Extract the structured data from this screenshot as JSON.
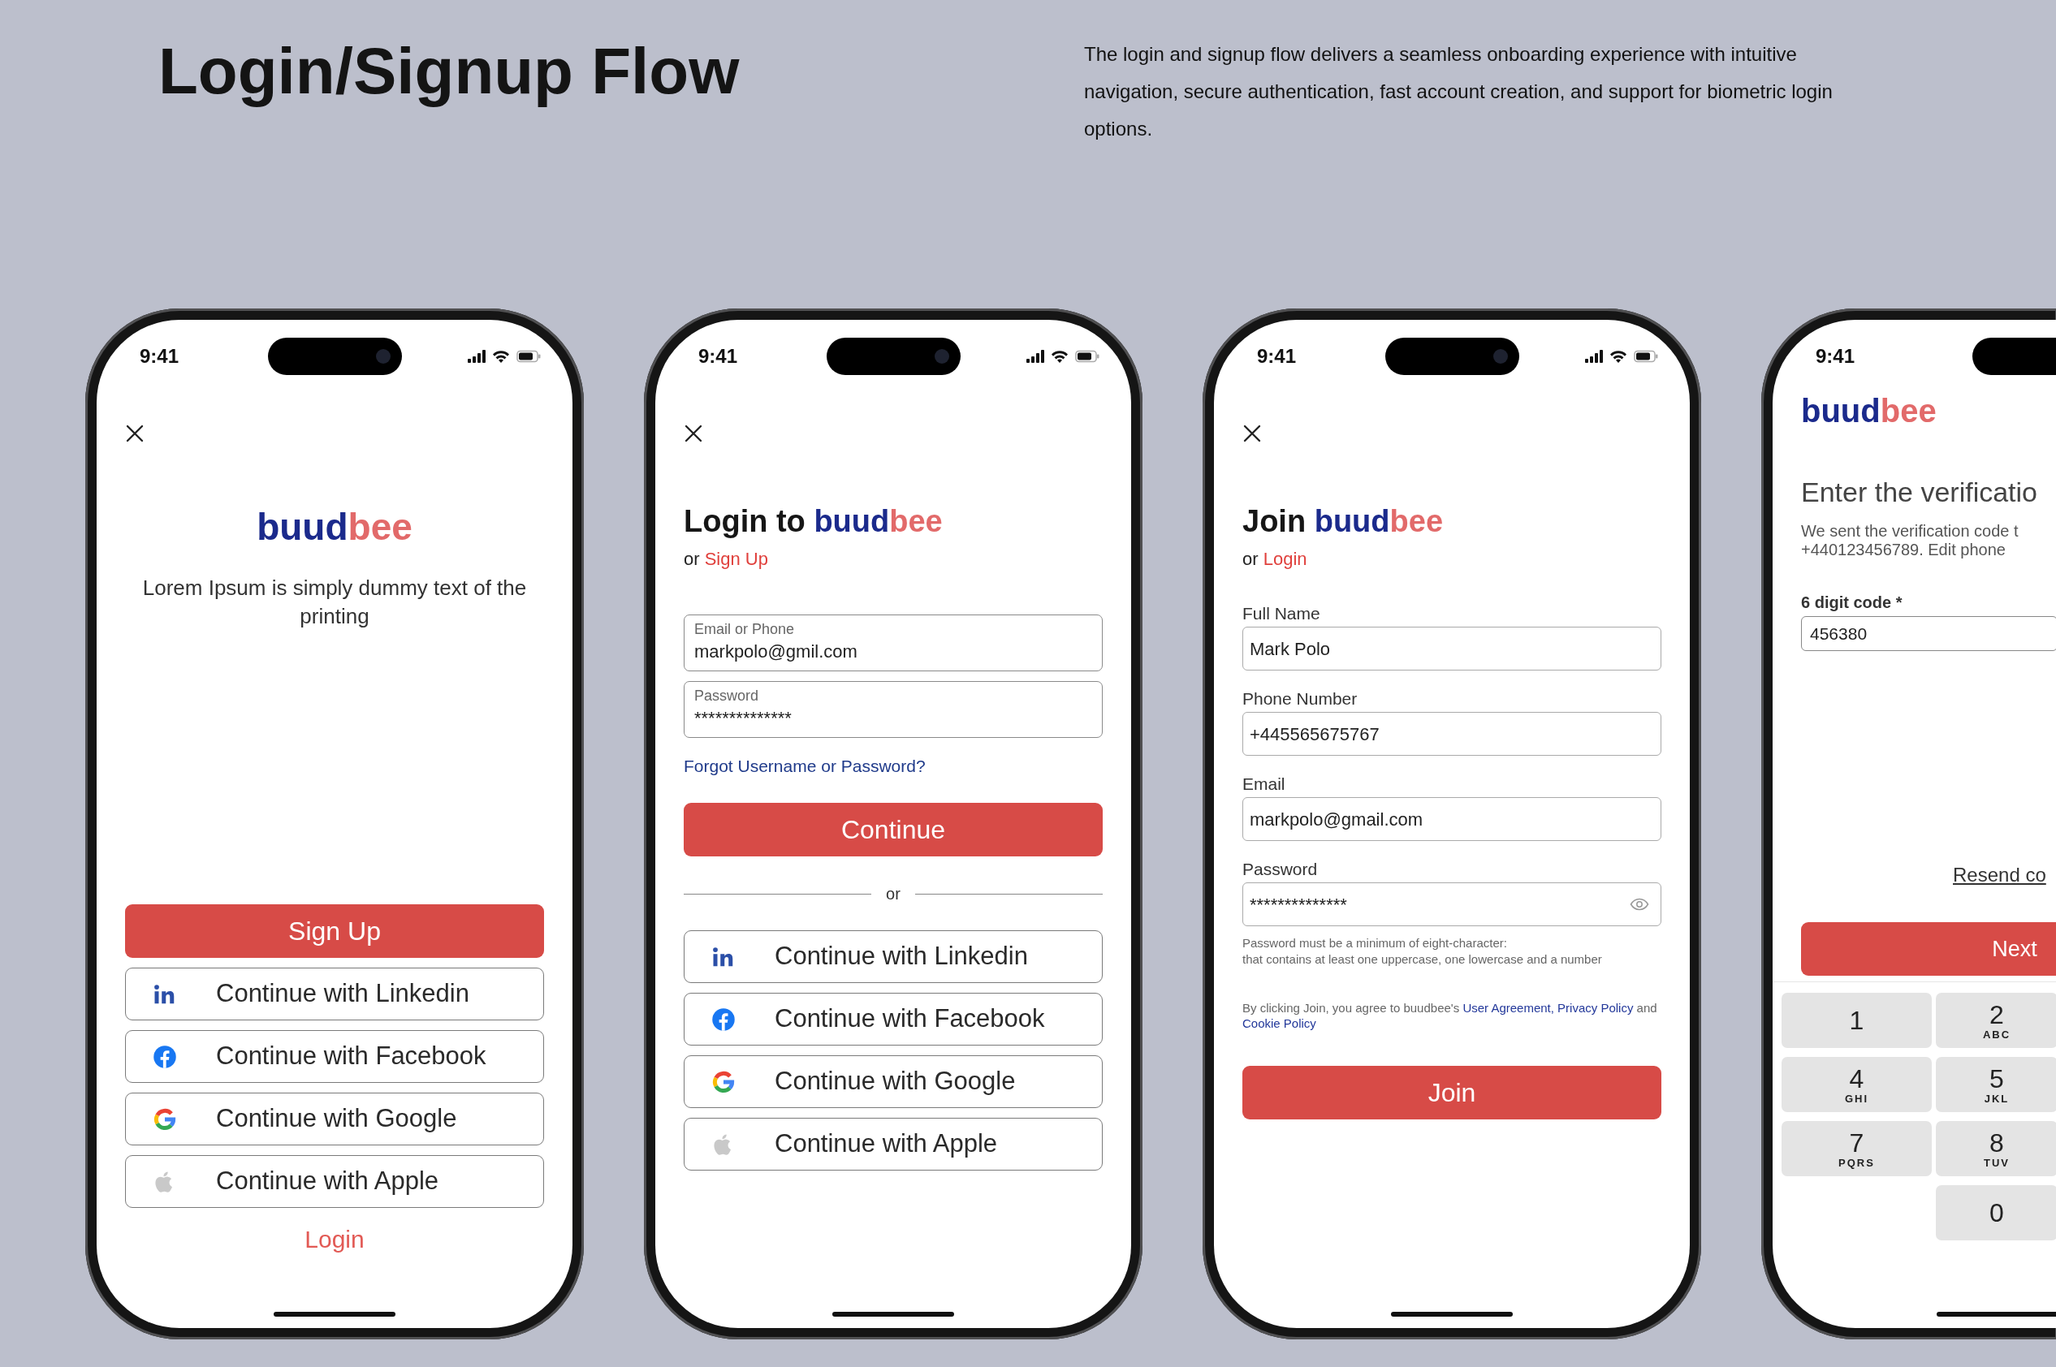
{
  "header": {
    "title": "Login/Signup Flow",
    "description": "The login and signup flow delivers a seamless onboarding experience with intuitive navigation, secure authentication, fast account creation, and support for biometric login options."
  },
  "phones": [
    {
      "kind": "welcome",
      "time": "9:41",
      "logo": {
        "first": "buud",
        "second": "bee"
      },
      "tagline": "Lorem Ipsum is simply dummy text of the printing",
      "primary_button": "Sign Up",
      "social_buttons": [
        {
          "kind": "linkedin",
          "label": "Continue with Linkedin"
        },
        {
          "kind": "facebook",
          "label": "Continue with Facebook"
        },
        {
          "kind": "google",
          "label": "Continue with Google"
        },
        {
          "kind": "apple",
          "label": "Continue with Apple"
        }
      ],
      "footer_link": "Login"
    },
    {
      "kind": "login",
      "time": "9:41",
      "heading": "Login to",
      "logo": {
        "first": "buud",
        "second": "bee"
      },
      "switch": {
        "prefix": "or",
        "link": "Sign Up"
      },
      "fields": [
        {
          "label": "Email or Phone",
          "value": "markpolo@gmil.com"
        },
        {
          "label": "Password",
          "value": "**************"
        }
      ],
      "forgot_link": "Forgot Username or Password?",
      "primary_button": "Continue",
      "divider": "or",
      "social_buttons": [
        {
          "kind": "linkedin",
          "label": "Continue with Linkedin"
        },
        {
          "kind": "facebook",
          "label": "Continue with Facebook"
        },
        {
          "kind": "google",
          "label": "Continue with Google"
        },
        {
          "kind": "apple",
          "label": "Continue with Apple"
        }
      ]
    },
    {
      "kind": "join",
      "time": "9:41",
      "heading": "Join",
      "logo": {
        "first": "buud",
        "second": "bee"
      },
      "switch": {
        "prefix": "or",
        "link": "Login"
      },
      "fields": [
        {
          "kind": "text",
          "label": "Full Name",
          "value": "Mark Polo"
        },
        {
          "kind": "text",
          "label": "Phone Number",
          "value": "+445565675767"
        },
        {
          "kind": "text",
          "label": "Email",
          "value": "markpolo@gmail.com"
        },
        {
          "kind": "password",
          "label": "Password",
          "value": "**************"
        }
      ],
      "password_hint": "Password must be a minimum of eight-character:\nthat contains at least one uppercase, one lowercase and a number",
      "consent": [
        {
          "kind": "text",
          "text": "By clicking Join, you agree to buudbee's "
        },
        {
          "kind": "link",
          "text": "User Agreement, Privacy Policy"
        },
        {
          "kind": "text",
          "text": " and "
        },
        {
          "kind": "link",
          "text": "Cookie Policy"
        }
      ],
      "primary_button": "Join"
    },
    {
      "kind": "verify",
      "time": "9:41",
      "logo": {
        "first": "buud",
        "second": "bee"
      },
      "heading": "Enter the verificatio",
      "message": [
        "We sent the verification code t",
        "+440123456789. Edit phone"
      ],
      "code_label": "6 digit code *",
      "code_value": "456380",
      "resend": "Resend co",
      "primary_button": "Next",
      "keys": [
        {
          "digit": "1"
        },
        {
          "digit": "2",
          "letters": "ABC"
        },
        {
          "digit": "4",
          "letters": "GHI"
        },
        {
          "digit": "5",
          "letters": "JKL"
        },
        {
          "digit": "7",
          "letters": "PQRS"
        },
        {
          "digit": "8",
          "letters": "TUV"
        },
        {
          "digit": "0"
        }
      ]
    }
  ]
}
